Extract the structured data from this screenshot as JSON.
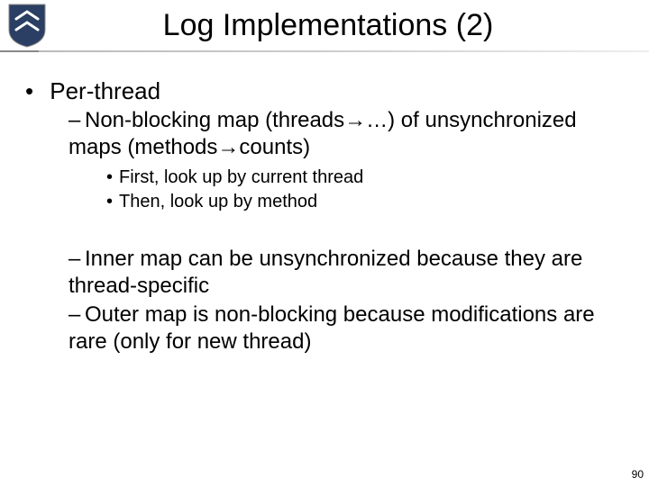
{
  "title": "Log Implementations (2)",
  "bullets": {
    "lvl1": "Per-thread",
    "lvl2a": "Non-blocking map (threads→…) of unsynchronized maps (methods→counts)",
    "lvl3a": "First, look up by current thread",
    "lvl3b": "Then, look up by method",
    "lvl2b": "Inner map can be unsynchronized because they are thread-specific",
    "lvl2c": "Outer map is non-blocking because modifications are rare (only for new thread)"
  },
  "pagenum": "90",
  "glyphs": {
    "bullet": "•",
    "dash": "–"
  }
}
